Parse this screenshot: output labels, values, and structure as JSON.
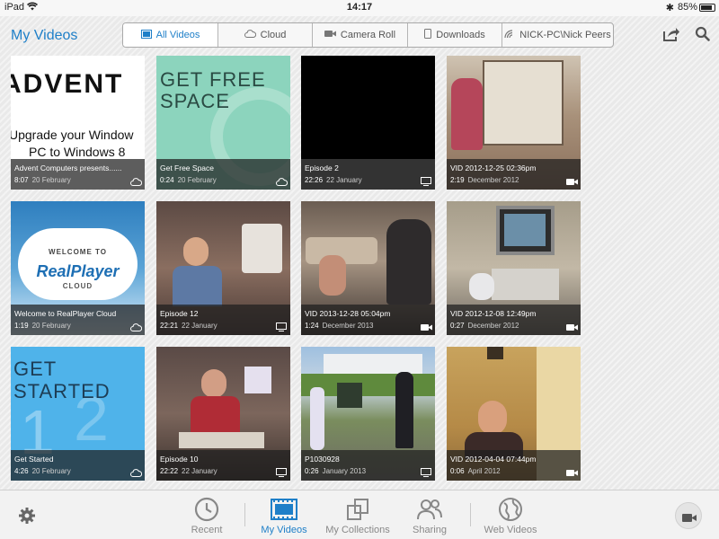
{
  "status_bar": {
    "device": "iPad",
    "time": "14:17",
    "battery": "85%"
  },
  "header": {
    "title": "My Videos",
    "tabs": [
      {
        "label": "All Videos",
        "icon": "video-list-icon",
        "active": true
      },
      {
        "label": "Cloud",
        "icon": "cloud-icon",
        "active": false
      },
      {
        "label": "Camera Roll",
        "icon": "camera-icon",
        "active": false
      },
      {
        "label": "Downloads",
        "icon": "phone-icon",
        "active": false
      },
      {
        "label": "NICK-PC\\Nick Peers",
        "icon": "network-icon",
        "active": false
      }
    ]
  },
  "videos": [
    {
      "title": "Advent Computers presents......",
      "duration": "8:07",
      "date": "20 February",
      "source": "cloud-icon",
      "thumb_text": [
        "ADVENT",
        "Upgrade your Window",
        "PC to Windows 8"
      ]
    },
    {
      "title": "Get Free Space",
      "duration": "0:24",
      "date": "20 February",
      "source": "cloud-icon",
      "thumb_text": [
        "GET FREE",
        "SPACE"
      ]
    },
    {
      "title": "Episode 2",
      "duration": "22:26",
      "date": "22 January",
      "source": "monitor-icon"
    },
    {
      "title": "VID 2012-12-25 02:36pm",
      "duration": "2:19",
      "date": "December 2012",
      "source": "camera-icon"
    },
    {
      "title": "Welcome to RealPlayer Cloud",
      "duration": "1:19",
      "date": "20 February",
      "source": "cloud-icon",
      "thumb_text": [
        "WELCOME TO",
        "RealPlayer",
        "CLOUD"
      ]
    },
    {
      "title": "Episode 12",
      "duration": "22:21",
      "date": "22 January",
      "source": "monitor-icon"
    },
    {
      "title": "VID 2013-12-28 05:04pm",
      "duration": "1:24",
      "date": "December 2013",
      "source": "camera-icon"
    },
    {
      "title": "VID 2012-12-08 12:49pm",
      "duration": "0:27",
      "date": "December 2012",
      "source": "camera-icon"
    },
    {
      "title": "Get Started",
      "duration": "4:26",
      "date": "20 February",
      "source": "cloud-icon",
      "thumb_text": [
        "GET",
        "STARTED"
      ]
    },
    {
      "title": "Episode 10",
      "duration": "22:22",
      "date": "22 January",
      "source": "monitor-icon"
    },
    {
      "title": "P1030928",
      "duration": "0:26",
      "date": "January 2013",
      "source": "monitor-icon"
    },
    {
      "title": "VID 2012-04-04 07:44pm",
      "duration": "0:06",
      "date": "April 2012",
      "source": "camera-icon"
    }
  ],
  "bottom_nav": [
    {
      "label": "Recent",
      "icon": "clock-icon",
      "active": false
    },
    {
      "label": "My Videos",
      "icon": "film-icon",
      "active": true
    },
    {
      "label": "My Collections",
      "icon": "collections-icon",
      "active": false
    },
    {
      "label": "Sharing",
      "icon": "people-icon",
      "active": false
    },
    {
      "label": "Web Videos",
      "icon": "globe-icon",
      "active": false
    }
  ],
  "colors": {
    "accent": "#1e7fc8",
    "inactive": "#888888",
    "overlay": "#1e1e1e"
  }
}
